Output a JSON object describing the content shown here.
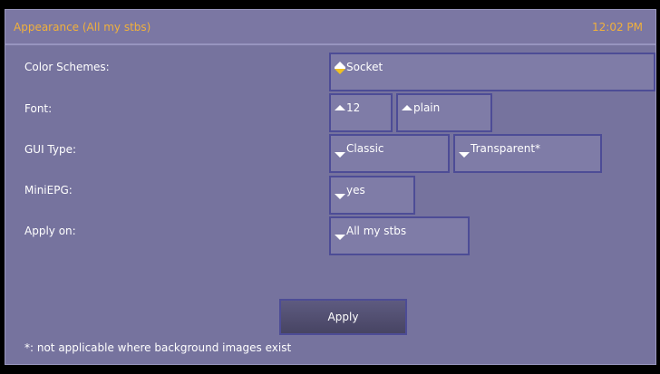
{
  "header": {
    "title": "Appearance (All my stbs)",
    "clock": "12:02 PM"
  },
  "form": {
    "color_schemes": {
      "label": "Color Schemes:",
      "value": "Socket"
    },
    "font": {
      "label": "Font:",
      "size": "12",
      "style": "plain"
    },
    "gui_type": {
      "label": "GUI Type:",
      "type": "Classic",
      "mode": "Transparent*"
    },
    "mini_epg": {
      "label": "MiniEPG:",
      "value": "yes"
    },
    "apply_on": {
      "label": "Apply on:",
      "value": "All my stbs"
    }
  },
  "actions": {
    "apply_label": "Apply"
  },
  "footnote": "*: not applicable where background images exist",
  "colors": {
    "accent": "#f0b03c",
    "panel": "#76739e",
    "border": "#4d4c96"
  }
}
